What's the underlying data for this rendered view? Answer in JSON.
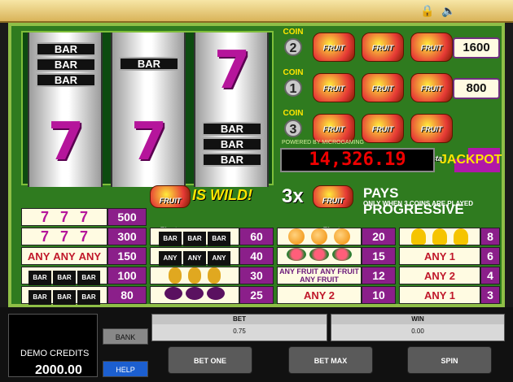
{
  "coin_rows": [
    {
      "coin": "2",
      "payout": "1600"
    },
    {
      "coin": "1",
      "payout": "800"
    },
    {
      "coin": "3",
      "payout": ""
    }
  ],
  "coin_label": "COIN",
  "fruit_label": "FRUIT Fiesta",
  "powered_by": "POWERED BY MICROGAMING",
  "jackpot": {
    "value": "14,326.19",
    "label": "JACKPOT"
  },
  "wild_text": "IS WILD!",
  "triple_text": "3x",
  "progressive": {
    "title": "PAYS PROGRESSIVE",
    "subtitle": "ONLY WHEN 3 COINS ARE PLAYED"
  },
  "paytable": {
    "col1": [
      "500",
      "300",
      "150",
      "100",
      "80"
    ],
    "col2": [
      "60",
      "40",
      "30",
      "25"
    ],
    "col3": [
      "20",
      "15",
      "12",
      "10"
    ],
    "col4": [
      "8",
      "6",
      "4",
      "3"
    ]
  },
  "symbols": {
    "any": "ANY",
    "any_fruit": "ANY FRUIT",
    "any1": "ANY 1",
    "any2": "ANY 2",
    "bar": "BAR"
  },
  "credits": {
    "label": "DEMO CREDITS",
    "value": "2000.00"
  },
  "buttons": {
    "bank": "BANK",
    "help": "HELP",
    "bet_one": "BET ONE",
    "bet_max": "BET MAX",
    "spin": "SPIN"
  },
  "bet": {
    "label": "BET",
    "value": "0.75"
  },
  "win": {
    "label": "WIN",
    "value": "0.00"
  }
}
